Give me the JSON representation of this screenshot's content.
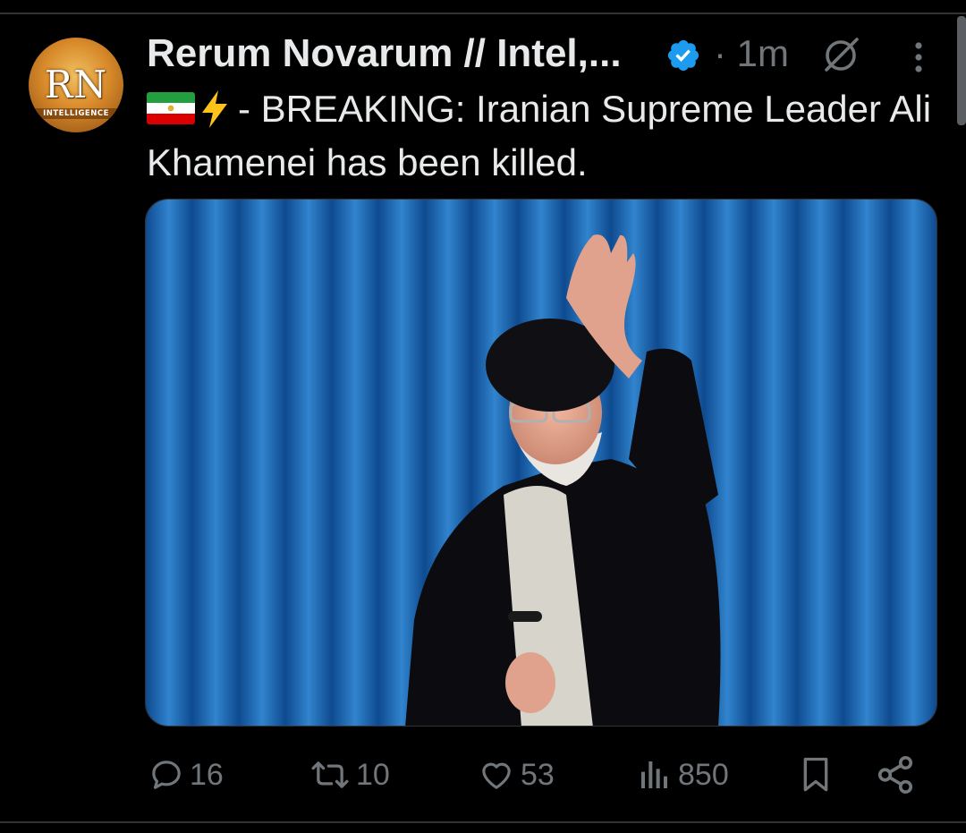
{
  "post": {
    "author": {
      "display_name": "Rerum Novarum // Intel,...",
      "avatar_text": "RN",
      "avatar_subtext": "INTELLIGENCE",
      "verified": true
    },
    "timestamp": "· 1m",
    "text": "- BREAKING: Iranian Supreme Leader Ali Khamenei has been killed.",
    "emoji": [
      "iran-flag",
      "high-voltage"
    ],
    "media": {
      "description": "photo",
      "background_color": "#1f6fb8"
    },
    "actions": {
      "replies": "16",
      "reposts": "10",
      "likes": "53",
      "views": "850"
    }
  },
  "colors": {
    "background": "#000000",
    "text": "#e7e9ea",
    "muted": "#71767b",
    "verified": "#1d9bf0",
    "divider": "#2f3336"
  }
}
